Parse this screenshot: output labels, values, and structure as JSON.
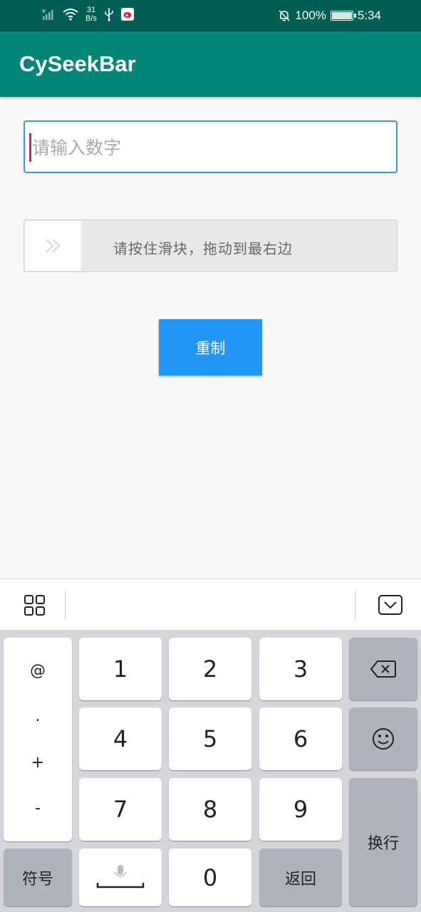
{
  "status_bar": {
    "net_speed_value": "31",
    "net_speed_unit": "B/s",
    "battery": "100%",
    "time": "5:34"
  },
  "app_bar": {
    "title": "CySeekBar"
  },
  "input": {
    "placeholder": "请输入数字",
    "value": ""
  },
  "slider": {
    "hint": "请按住滑块，拖动到最右边",
    "progress": 0
  },
  "reset_button": {
    "label": "重制"
  },
  "keyboard": {
    "symbols": [
      "@",
      ".",
      "+",
      "-"
    ],
    "digits": [
      "1",
      "2",
      "3",
      "4",
      "5",
      "6",
      "7",
      "8",
      "9",
      "0"
    ],
    "symbol_key": "符号",
    "back_key": "返回",
    "enter_key": "换行"
  }
}
